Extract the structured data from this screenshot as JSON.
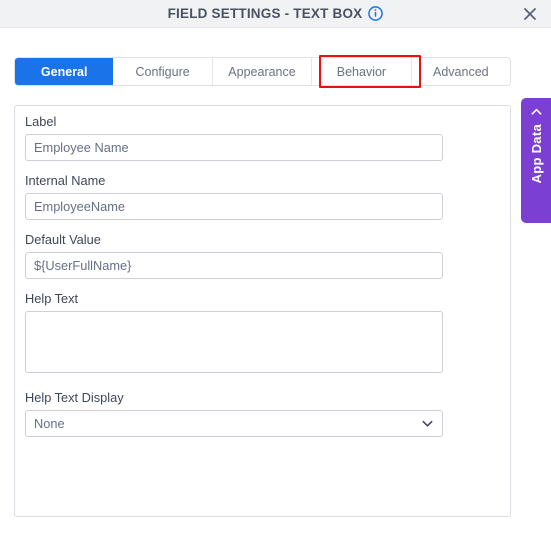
{
  "header": {
    "title": "FIELD SETTINGS - TEXT BOX",
    "info_icon": "info-circle-icon",
    "close_icon": "close-icon"
  },
  "tabs": [
    {
      "label": "General",
      "active": true
    },
    {
      "label": "Configure",
      "active": false
    },
    {
      "label": "Appearance",
      "active": false
    },
    {
      "label": "Behavior",
      "active": false
    },
    {
      "label": "Advanced",
      "active": false
    }
  ],
  "annotation": {
    "target": "Behavior",
    "color": "#e8110c"
  },
  "form": {
    "label_field": {
      "label": "Label",
      "value": "Employee Name"
    },
    "internal_name": {
      "label": "Internal Name",
      "value": "EmployeeName"
    },
    "default_value": {
      "label": "Default Value",
      "value": "${UserFullName}"
    },
    "help_text": {
      "label": "Help Text",
      "value": ""
    },
    "help_text_display": {
      "label": "Help Text Display",
      "value": "None",
      "chevron": "chevron-down-icon"
    }
  },
  "side_panel": {
    "label": "App Data",
    "chevron": "chevron-left-icon",
    "color": "#7c3fd4"
  },
  "colors": {
    "accent": "#1a73e8",
    "header_bg": "#f1f2f4",
    "annotation": "#e8110c",
    "purple": "#7c3fd4"
  }
}
